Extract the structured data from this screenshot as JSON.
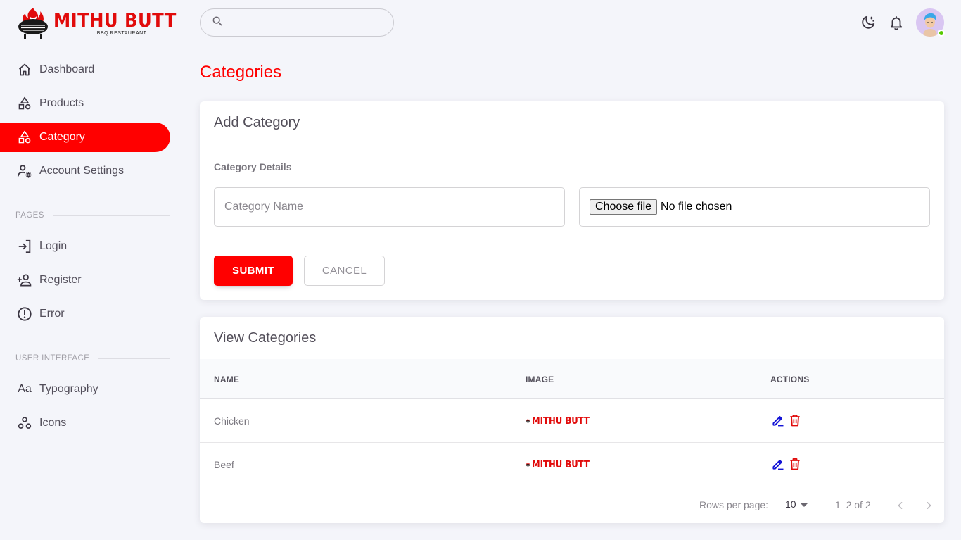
{
  "brand": {
    "name": "MITHU BUTT",
    "tagline": "BBQ RESTAURANT",
    "accent": "#ff0000"
  },
  "sidebar": {
    "items": [
      {
        "label": "Dashboard",
        "icon": "home-icon"
      },
      {
        "label": "Products",
        "icon": "shapes-icon"
      },
      {
        "label": "Category",
        "icon": "shapes-icon",
        "active": true
      },
      {
        "label": "Account Settings",
        "icon": "account-cog-icon"
      }
    ],
    "section_pages": "PAGES",
    "pages": [
      {
        "label": "Login",
        "icon": "login-icon"
      },
      {
        "label": "Register",
        "icon": "account-plus-icon"
      },
      {
        "label": "Error",
        "icon": "alert-circle-icon"
      }
    ],
    "section_ui": "USER INTERFACE",
    "ui": [
      {
        "label": "Typography",
        "icon": "format-letter-case-icon"
      },
      {
        "label": "Icons",
        "icon": "google-circles-icon"
      }
    ]
  },
  "header": {
    "search_placeholder": ""
  },
  "page": {
    "title": "Categories"
  },
  "add_card": {
    "title": "Add Category",
    "subtitle": "Category Details",
    "name_placeholder": "Category Name",
    "file_button": "Choose file",
    "file_status": "No file chosen",
    "submit": "SUBMIT",
    "cancel": "CANCEL"
  },
  "view_card": {
    "title": "View Categories",
    "columns": [
      "NAME",
      "IMAGE",
      "ACTIONS"
    ],
    "rows": [
      {
        "name": "Chicken",
        "image": "MITHU BUTT"
      },
      {
        "name": "Beef",
        "image": "MITHU BUTT"
      }
    ],
    "rows_per_page_label": "Rows per page:",
    "rows_per_page": "10",
    "range": "1–2 of 2"
  },
  "status": {
    "online_color": "#56ca00"
  }
}
